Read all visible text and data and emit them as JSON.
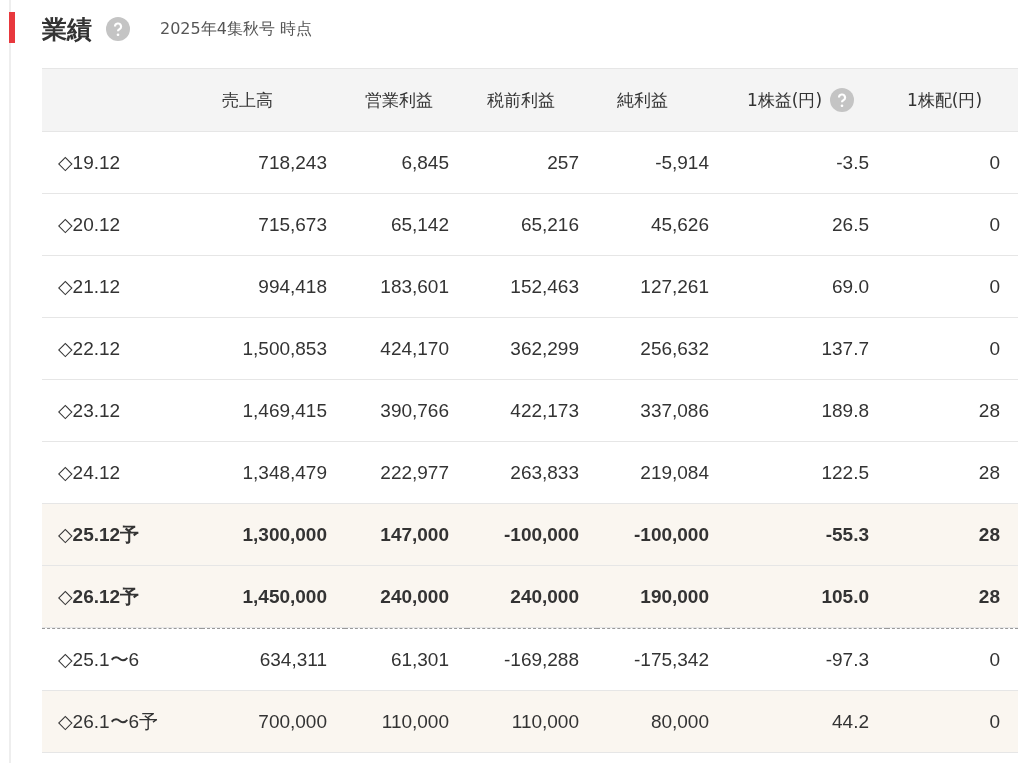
{
  "section": {
    "title": "業績",
    "subtitle": "2025年4集秋号 時点"
  },
  "table": {
    "columns": [
      {
        "help": false
      },
      {
        "label": "売上高",
        "help": false
      },
      {
        "label": "営業利益",
        "help": false
      },
      {
        "label": "税前利益",
        "help": false
      },
      {
        "label": "純利益",
        "help": false
      },
      {
        "label": "1株益(円)",
        "help": true
      },
      {
        "label": "1株配(円)",
        "help": false
      }
    ],
    "rows": [
      {
        "kind": "actual",
        "cells": [
          "◇19.12",
          "718,243",
          "6,845",
          "257",
          "-5,914",
          "-3.5",
          "0"
        ]
      },
      {
        "kind": "actual",
        "cells": [
          "◇20.12",
          "715,673",
          "65,142",
          "65,216",
          "45,626",
          "26.5",
          "0"
        ]
      },
      {
        "kind": "actual",
        "cells": [
          "◇21.12",
          "994,418",
          "183,601",
          "152,463",
          "127,261",
          "69.0",
          "0"
        ]
      },
      {
        "kind": "actual",
        "cells": [
          "◇22.12",
          "1,500,853",
          "424,170",
          "362,299",
          "256,632",
          "137.7",
          "0"
        ]
      },
      {
        "kind": "actual",
        "cells": [
          "◇23.12",
          "1,469,415",
          "390,766",
          "422,173",
          "337,086",
          "189.8",
          "28"
        ]
      },
      {
        "kind": "actual",
        "cells": [
          "◇24.12",
          "1,348,479",
          "222,977",
          "263,833",
          "219,084",
          "122.5",
          "28"
        ]
      },
      {
        "kind": "forecast",
        "cells": [
          "◇25.12予",
          "1,300,000",
          "147,000",
          "-100,000",
          "-100,000",
          "-55.3",
          "28"
        ]
      },
      {
        "kind": "forecast",
        "cells": [
          "◇26.12予",
          "1,450,000",
          "240,000",
          "240,000",
          "190,000",
          "105.0",
          "28"
        ]
      },
      {
        "kind": "interim",
        "cells": [
          "◇25.1〜6",
          "634,311",
          "61,301",
          "-169,288",
          "-175,342",
          "-97.3",
          "0"
        ]
      },
      {
        "kind": "interim_forecast",
        "cells": [
          "◇26.1〜6予",
          "700,000",
          "110,000",
          "110,000",
          "80,000",
          "44.2",
          "0"
        ]
      }
    ]
  }
}
